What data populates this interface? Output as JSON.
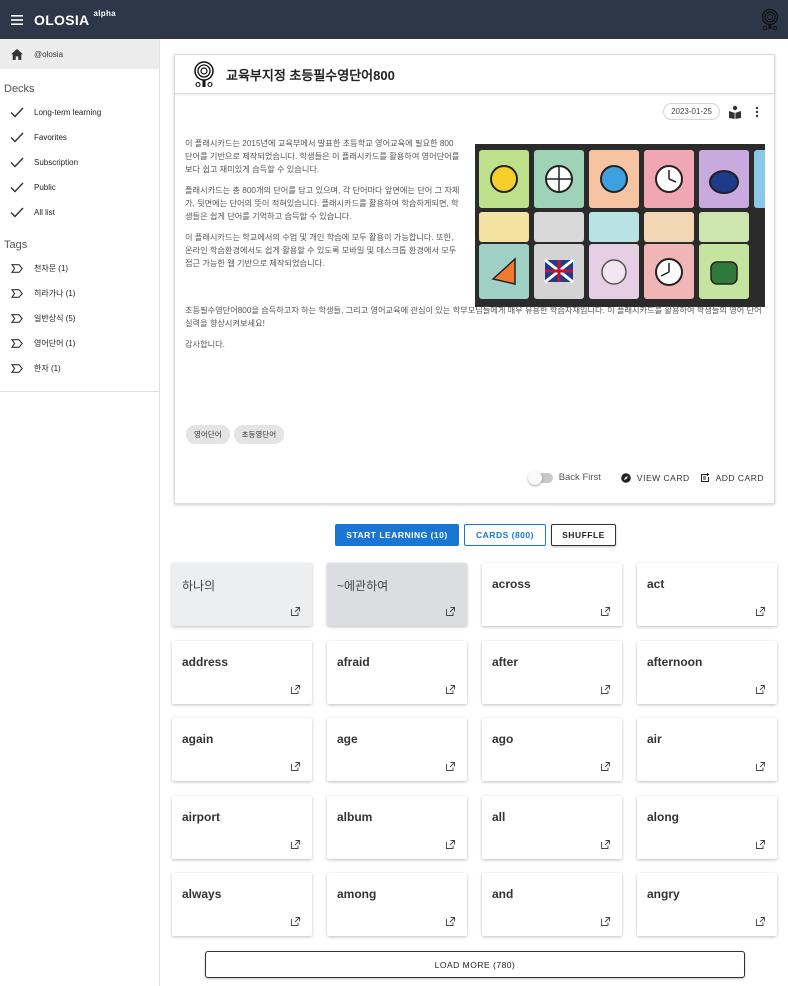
{
  "app": {
    "brand": "OLOSIA",
    "brand_sup": "alpha"
  },
  "sidebar": {
    "user": "@olosia",
    "decks_heading": "Decks",
    "decks": [
      {
        "label": "Long-term learning"
      },
      {
        "label": "Favorites"
      },
      {
        "label": "Subscription"
      },
      {
        "label": "Public"
      },
      {
        "label": "All list"
      }
    ],
    "tags_heading": "Tags",
    "tags": [
      {
        "label": "천자문 (1)"
      },
      {
        "label": "히라가나 (1)"
      },
      {
        "label": "일반상식 (5)"
      },
      {
        "label": "영어단어 (1)"
      },
      {
        "label": "한자 (1)"
      }
    ]
  },
  "deck": {
    "title": "교육부지정 초등필수영단어800",
    "date": "2023-01-25",
    "desc": [
      "이 플래시카드는 2015년에 교육부에서 발표한 초등학교 영어교육에 필요한 800 단어를 기반으로 제작되었습니다. 학생들은 이 플래시카드를 활용하여 영어단어를 보다 쉽고 재미있게 습득할 수 있습니다.",
      "플래시카드는 총 800개의 단어를 담고 있으며, 각 단어마다 앞면에는 단어 그 자체가, 뒷면에는 단어의 뜻이 적혀있습니다. 플래시카드를 활용하여 학습하게되면, 학생들은 쉽게 단어를 기억하고 습득할 수 있습니다.",
      "이 플래시카드는 학교에서의 수업 및 개인 학습에 모두 활용이 가능합니다. 또한, 온라인 학습환경에서도 쉽게 활용할 수 있도록 모바일 및 데스크톱 환경에서 모두 접근 가능한 웹 기반으로 제작되었습니다."
    ],
    "desc_wide": [
      "초등필수영단어800을 습득하고자 하는 학생들, 그리고 영어교육에 관심이 있는 학부모님들에게 매우 유용한 학습자재입니다. 이 플래시카드를 활용하여 학생들의 영어 단어 실력을 향상시켜보세요!",
      "감사합니다."
    ],
    "tags": [
      "영어단어",
      "초등영단어"
    ],
    "toggle_label": "Back First",
    "view_card": "VIEW CARD",
    "add_card": "ADD CARD"
  },
  "buttons": {
    "start": "START LEARNING (10)",
    "cards": "CARDS (800)",
    "shuffle": "SHUFFLE"
  },
  "cards": [
    {
      "word": "하나의"
    },
    {
      "word": "~에관하여"
    },
    {
      "word": "across"
    },
    {
      "word": "act"
    },
    {
      "word": "address"
    },
    {
      "word": "afraid"
    },
    {
      "word": "after"
    },
    {
      "word": "afternoon"
    },
    {
      "word": "again"
    },
    {
      "word": "age"
    },
    {
      "word": "ago"
    },
    {
      "word": "air"
    },
    {
      "word": "airport"
    },
    {
      "word": "album"
    },
    {
      "word": "all"
    },
    {
      "word": "along"
    },
    {
      "word": "always"
    },
    {
      "word": "among"
    },
    {
      "word": "and"
    },
    {
      "word": "angry"
    }
  ],
  "load_more": "LOAD MORE (780)",
  "colors": {
    "appbar": "#2d3748",
    "primary": "#1976d2"
  }
}
